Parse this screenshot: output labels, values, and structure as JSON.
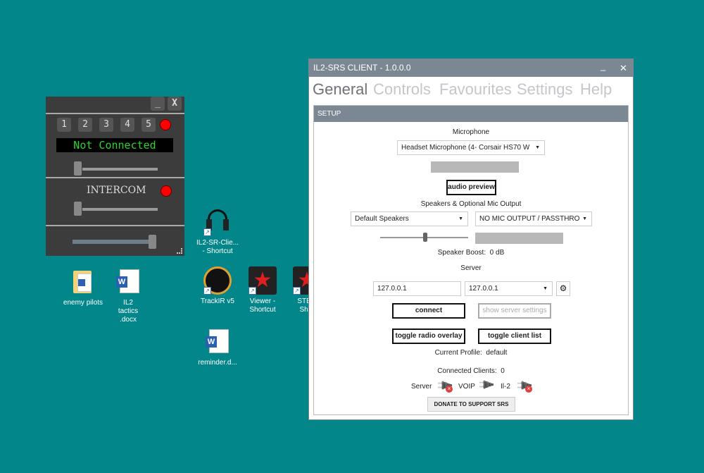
{
  "desktop": {
    "icons": [
      {
        "label": "enemy pilots",
        "type": "folder"
      },
      {
        "label": "IL2 tactics .docx",
        "type": "word-doc"
      },
      {
        "label": "IL2-SR-Clie... - Shortcut",
        "type": "headset"
      },
      {
        "label": "TrackIR v5",
        "type": "trackir"
      },
      {
        "label": "Viewer - Shortcut",
        "type": "star-app"
      },
      {
        "label": "STEdi Shor",
        "type": "star-app"
      },
      {
        "label": "reminder.d...",
        "type": "word-doc"
      }
    ]
  },
  "overlay": {
    "minimize": "_",
    "close": "X",
    "channels": [
      "1",
      "2",
      "3",
      "4",
      "5"
    ],
    "status": "Not Connected",
    "intercom": "INTERCOM",
    "status_color": "#2bd42b",
    "led_color": "#ff0000",
    "radio_volume": 0,
    "intercom_volume": 0,
    "master_volume": 100
  },
  "srs": {
    "title": "IL2-SRS CLIENT - 1.0.0.0",
    "minimize": "_",
    "close": "✕",
    "tabs": [
      "General",
      "Controls",
      "Favourites",
      "Settings",
      "Help"
    ],
    "active_tab": "General",
    "setup_header": "SETUP",
    "microphone_label": "Microphone",
    "microphone_value": "Headset Microphone (4- Corsair HS70 W",
    "audio_preview": "audio preview",
    "speakers_label": "Speakers & Optional Mic Output",
    "speakers_value": "Default Speakers",
    "mic_output_value": "NO MIC OUTPUT / PASSTHROU",
    "speaker_boost_label": "Speaker Boost:",
    "speaker_boost_value": "0 dB",
    "speaker_boost_slider": 0.5,
    "server_label": "Server",
    "server_input": "127.0.0.1",
    "server_select": "127.0.0.1",
    "connect": "connect",
    "show_server_settings": "show server settings",
    "toggle_radio_overlay": "toggle radio overlay",
    "toggle_client_list": "toggle client list",
    "current_profile_label": "Current Profile:",
    "current_profile_value": "default",
    "connected_clients_label": "Connected Clients:",
    "connected_clients_value": "0",
    "status": [
      {
        "label": "Server",
        "connected": false
      },
      {
        "label": "VOIP",
        "connected": true
      },
      {
        "label": "Il-2",
        "connected": false
      }
    ],
    "donate": "DONATE TO SUPPORT SRS"
  }
}
